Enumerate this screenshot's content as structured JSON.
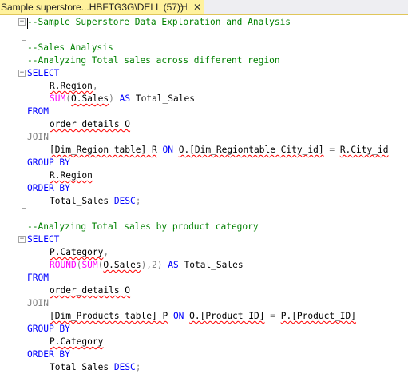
{
  "tab": {
    "title": "Sample superstore...HBFTG3G\\DELL (57))",
    "pin_glyph": "⊣",
    "close_glyph": "✕"
  },
  "code": {
    "l1": "--Sample Superstore Data Exploration and Analysis",
    "l3": "--Sales Analysis",
    "l4": "--Analyzing Total sales across different region",
    "select": "SELECT",
    "from": "FROM",
    "join": "JOIN",
    "group_by": "GROUP BY",
    "order_by": "ORDER BY",
    "on": "ON",
    "as": "AS",
    "desc": "DESC",
    "q1": {
      "region_col": "R.Region",
      "comma": ",",
      "sum_fn": "SUM",
      "sum_arg": "O.Sales",
      "alias": "Total_Sales",
      "table": "order_details O",
      "join_table": "[Dim_Region table] R",
      "join_left": "O.[Dim_Regiontable City_id]",
      "eq": "=",
      "join_right": "R.City_id",
      "group_col": "R.Region",
      "order_col": "Total_Sales"
    },
    "l16": "--Analyzing Total sales by product category",
    "q2": {
      "cat_col": "P.Category",
      "comma": ",",
      "round_fn": "ROUND",
      "sum_fn": "SUM",
      "sum_arg": "O.Sales",
      "round_digits": "),2)",
      "alias": "Total_Sales",
      "table": "order_details O",
      "join_table": "[Dim_Products table] P",
      "join_left": "O.[Product ID]",
      "eq": "=",
      "join_right": "P.[Product_ID]",
      "group_col": "P.Category",
      "order_col": "Total_Sales"
    }
  }
}
